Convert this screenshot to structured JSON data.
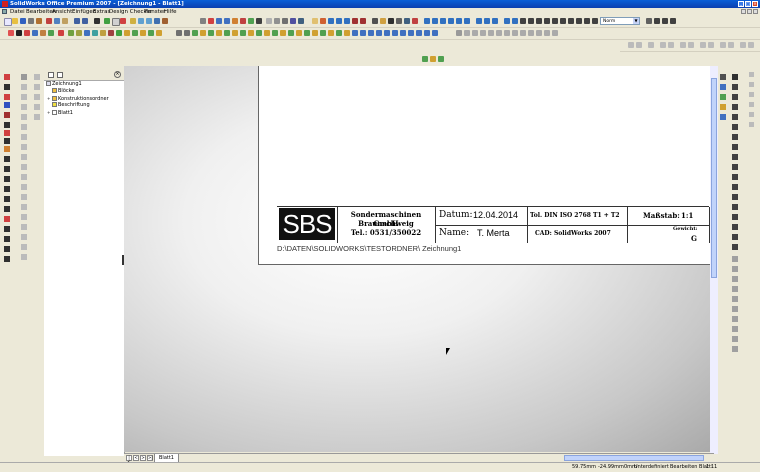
{
  "window": {
    "title": "SolidWorks Office Premium 2007 - [Zeichnung1 - Blatt1]"
  },
  "menu": {
    "items": [
      "Datei",
      "Bearbeiten",
      "Ansicht",
      "Einfügen",
      "Extras",
      "Design Checker",
      "Fenster",
      "Hilfe"
    ]
  },
  "toolbar": {
    "zoom_select_value": "Norm"
  },
  "feature_tree": {
    "items": [
      {
        "label": "Zeichnung1",
        "icon": "drawing-icon"
      },
      {
        "label": "Blöcke",
        "icon": "folder-icon"
      },
      {
        "label": "Konstruktionsordner",
        "icon": "folder-icon"
      },
      {
        "label": "Beschriftung",
        "icon": "annotation-icon"
      },
      {
        "label": "Blatt1",
        "icon": "sheet-icon"
      }
    ]
  },
  "title_block": {
    "logo_text": "SBS",
    "company_line1": "Sondermaschinen GmbH",
    "company_line2": "Braunschweig",
    "company_tel": "Tel.: 0531/350022",
    "datum_label": "Datum:",
    "datum_value": "12.04.2014",
    "name_label": "Name:",
    "name_value": "T. Merta",
    "norm_text": "Tol. DIN ISO 2768 T1 + T2",
    "cad_text": "CAD: SolidWorks 2007",
    "scale_label": "Maßstab:",
    "scale_value": "1:1",
    "weight_label": "Gewicht:",
    "weight_value": "G"
  },
  "file_path": "D:\\DATEN\\SOLIDWORKS\\TESTORDNER\\ Zeichnung1",
  "sheet_tabs": [
    "Blatt1"
  ],
  "status": {
    "x": "59.75mm",
    "y": "-24.99mm",
    "z": "0mm",
    "definition": "Unterdefiniert",
    "editing": "Bearbeiten Blatt1",
    "scale": "1 : 1"
  }
}
